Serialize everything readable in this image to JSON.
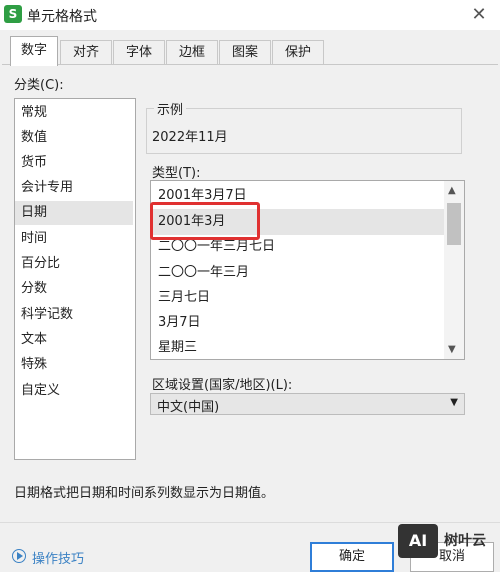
{
  "dialog": {
    "title": "单元格格式",
    "app_icon": "S"
  },
  "tabs": [
    {
      "label": "数字"
    },
    {
      "label": "对齐"
    },
    {
      "label": "字体"
    },
    {
      "label": "边框"
    },
    {
      "label": "图案"
    },
    {
      "label": "保护"
    }
  ],
  "category": {
    "label": "分类(C):",
    "items": [
      "常规",
      "数值",
      "货币",
      "会计专用",
      "日期",
      "时间",
      "百分比",
      "分数",
      "科学记数",
      "文本",
      "特殊",
      "自定义"
    ],
    "selected": "日期"
  },
  "sample": {
    "label": "示例",
    "value": "2022年11月"
  },
  "type": {
    "label": "类型(T):",
    "items": [
      "2001年3月7日",
      "2001年3月",
      "二〇〇一年三月七日",
      "二〇〇一年三月",
      "三月七日",
      "3月7日",
      "星期三"
    ],
    "selected": "2001年3月"
  },
  "locale": {
    "label": "区域设置(国家/地区)(L):",
    "value": "中文(中国)"
  },
  "description": "日期格式把日期和时间系列数显示为日期值。",
  "footer": {
    "tips": "操作技巧",
    "ok": "确定",
    "cancel": "取消"
  },
  "watermark": {
    "badge": "AI",
    "text": "树叶云"
  },
  "colors": {
    "highlight": "#e03131",
    "link": "#3b82c4",
    "ok_border": "#2f7ed8"
  }
}
